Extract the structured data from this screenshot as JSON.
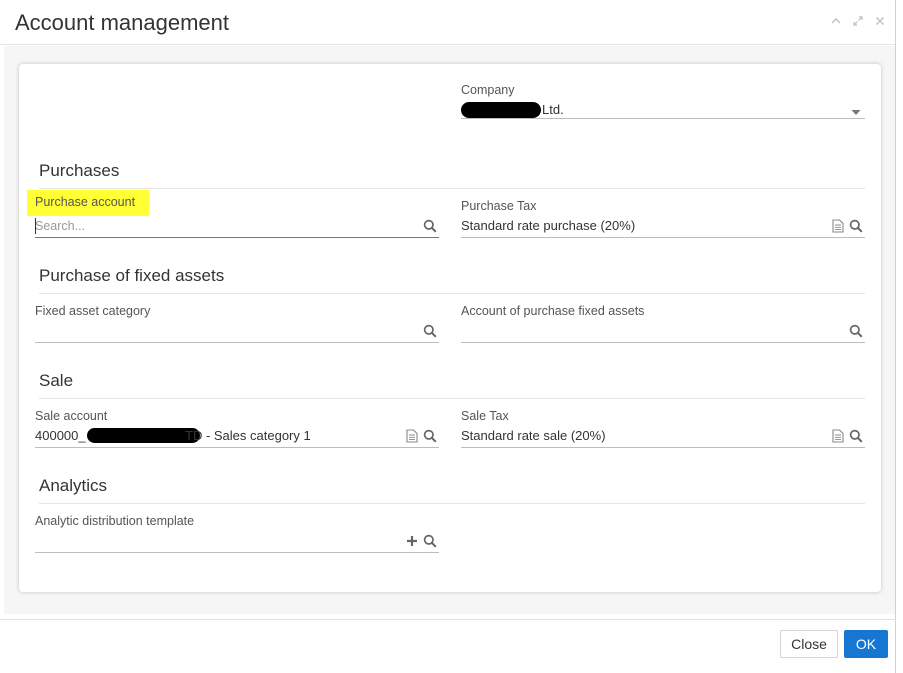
{
  "dialog": {
    "title": "Account management",
    "controls": [
      "collapse-icon",
      "expand-icon",
      "close-icon"
    ]
  },
  "company": {
    "label": "Company",
    "value_suffix": "Ltd."
  },
  "sections": {
    "purchases": "Purchases",
    "fixed_assets": "Purchase of fixed assets",
    "sale": "Sale",
    "analytics": "Analytics"
  },
  "fields": {
    "purchase_account": {
      "label": "Purchase account",
      "placeholder": "Search..."
    },
    "purchase_tax": {
      "label": "Purchase Tax",
      "value": "Standard rate purchase (20%)"
    },
    "fixed_asset_category": {
      "label": "Fixed asset category",
      "value": ""
    },
    "account_purchase_fixed_assets": {
      "label": "Account of purchase fixed assets",
      "value": ""
    },
    "sale_account": {
      "label": "Sale account",
      "value_prefix": "400000_",
      "value_suffix": "TD - Sales category 1"
    },
    "sale_tax": {
      "label": "Sale Tax",
      "value": "Standard rate sale (20%)"
    },
    "analytic_template": {
      "label": "Analytic distribution template",
      "value": ""
    }
  },
  "footer": {
    "close_label": "Close",
    "ok_label": "OK"
  },
  "colors": {
    "primary": "#1677d2",
    "highlight": "#ffff33",
    "active_line": "#4a7fb8"
  }
}
